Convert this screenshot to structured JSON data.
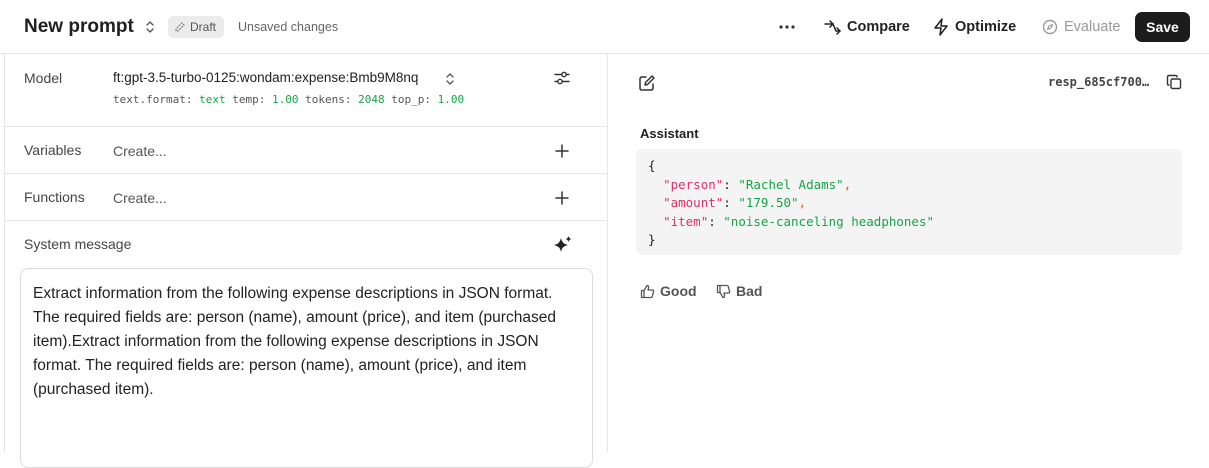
{
  "header": {
    "title": "New prompt",
    "draft_label": "Draft",
    "unsaved": "Unsaved changes",
    "compare_label": "Compare",
    "optimize_label": "Optimize",
    "evaluate_label": "Evaluate",
    "save_label": "Save"
  },
  "model": {
    "label": "Model",
    "value": "ft:gpt-3.5-turbo-0125:wondam:expense:Bmb9M8nq",
    "params": [
      {
        "key": "text.format:",
        "value": "text"
      },
      {
        "key": "temp:",
        "value": "1.00"
      },
      {
        "key": "tokens:",
        "value": "2048"
      },
      {
        "key": "top_p:",
        "value": "1.00"
      }
    ]
  },
  "variables": {
    "label": "Variables",
    "create": "Create..."
  },
  "functions": {
    "label": "Functions",
    "create": "Create..."
  },
  "system": {
    "label": "System message",
    "text": "Extract information from the following expense descriptions in JSON format. The required fields are: person (name), amount (price), and item (purchased item).Extract information from the following expense descriptions in JSON format. The required fields are: person (name), amount (price), and item (purchased item)."
  },
  "response": {
    "id": "resp_685cf700…",
    "role": "Assistant",
    "json": [
      {
        "key": "\"person\"",
        "value": "\"Rachel Adams\""
      },
      {
        "key": "\"amount\"",
        "value": "\"179.50\""
      },
      {
        "key": "\"item\"",
        "value": "\"noise-canceling headphones\""
      }
    ],
    "good_label": "Good",
    "bad_label": "Bad"
  },
  "colors": {
    "accent_green": "#16a34a",
    "json_key": "#d6336c",
    "save_bg": "#1c1c1c"
  }
}
